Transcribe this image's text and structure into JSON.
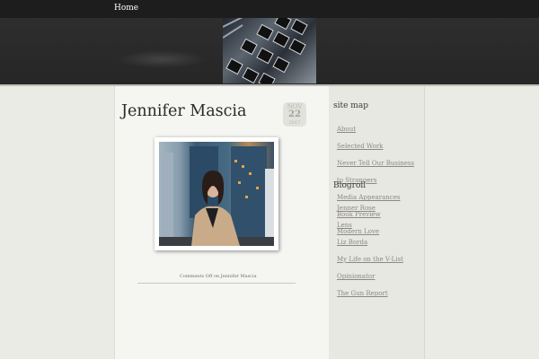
{
  "nav": {
    "home_label": "Home"
  },
  "post": {
    "title": "Jennifer Mascia",
    "date": {
      "month": "NOV",
      "day": "22",
      "year": "2017"
    },
    "comments_text": "Comments Off on Jennifer Mascia"
  },
  "sidebar": {
    "site_map": {
      "heading": "site map",
      "items": [
        {
          "label": "About"
        },
        {
          "label": "Selected Work"
        },
        {
          "label": "Never Tell Our Business to Strangers"
        },
        {
          "label": "Media Appearances"
        },
        {
          "label": "Book Preview"
        },
        {
          "label": "Modern Love"
        }
      ]
    },
    "blogroll": {
      "heading": "Blogroll",
      "items": [
        {
          "label": "Jenner Rose"
        },
        {
          "label": "Lens"
        },
        {
          "label": "Liz Borda"
        },
        {
          "label": "My Life on the V-List"
        },
        {
          "label": "Opinionator"
        },
        {
          "label": "The Gun Report"
        }
      ]
    }
  }
}
